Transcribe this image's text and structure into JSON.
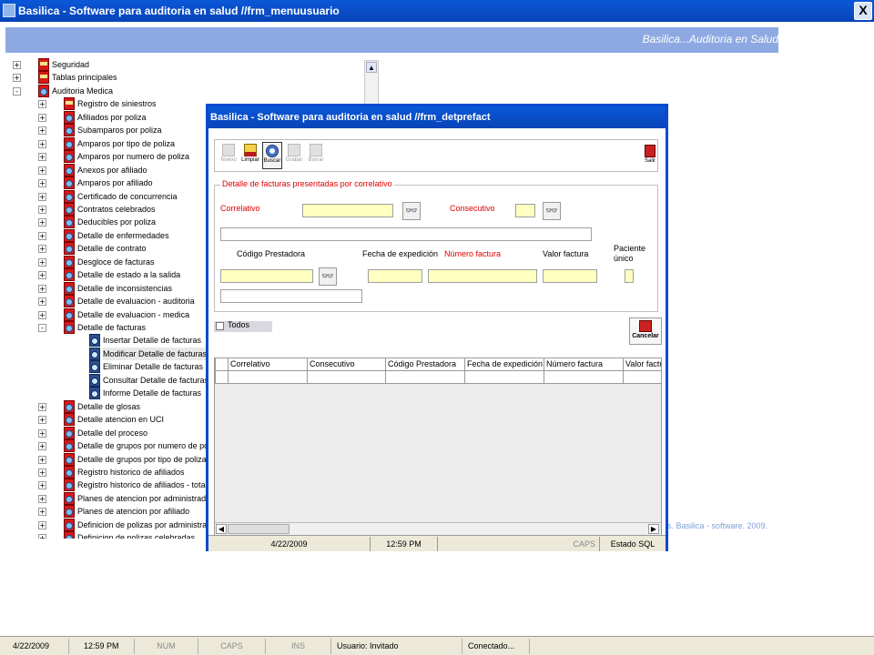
{
  "window": {
    "title": "Basilica - Software para auditoria en salud //frm_menuusuario",
    "close_glyph": "X"
  },
  "banner": {
    "text": "Basilica...Auditoria  en  Salud"
  },
  "tree": [
    {
      "label": "Seguridad",
      "level": 0,
      "expander": "+",
      "icon": "folder-icon"
    },
    {
      "label": "Tablas principales",
      "level": 0,
      "expander": "+",
      "icon": "folder-icon"
    },
    {
      "label": "Auditoria Medica",
      "level": 0,
      "expander": "-",
      "icon": "magnify-icon"
    },
    {
      "label": "Registro de siniestros",
      "level": 1,
      "expander": "+",
      "icon": "folder-icon"
    },
    {
      "label": "Afiliados por poliza",
      "level": 1,
      "expander": "+",
      "icon": "magnify-icon"
    },
    {
      "label": "Subamparos por poliza",
      "level": 1,
      "expander": "+",
      "icon": "magnify-icon"
    },
    {
      "label": "Amparos por tipo de poliza",
      "level": 1,
      "expander": "+",
      "icon": "magnify-icon"
    },
    {
      "label": "Amparos por numero de poliza",
      "level": 1,
      "expander": "+",
      "icon": "magnify-icon"
    },
    {
      "label": "Anexos por afiliado",
      "level": 1,
      "expander": "+",
      "icon": "magnify-icon"
    },
    {
      "label": "Amparos por afiliado",
      "level": 1,
      "expander": "+",
      "icon": "magnify-icon"
    },
    {
      "label": "Certificado de concurrencia",
      "level": 1,
      "expander": "+",
      "icon": "magnify-icon"
    },
    {
      "label": "Contratos celebrados",
      "level": 1,
      "expander": "+",
      "icon": "magnify-icon"
    },
    {
      "label": "Deducibles por poliza",
      "level": 1,
      "expander": "+",
      "icon": "magnify-icon"
    },
    {
      "label": "Detalle de enfermedades",
      "level": 1,
      "expander": "+",
      "icon": "magnify-icon"
    },
    {
      "label": "Detalle de contrato",
      "level": 1,
      "expander": "+",
      "icon": "magnify-icon"
    },
    {
      "label": "Desgloce de facturas",
      "level": 1,
      "expander": "+",
      "icon": "magnify-icon"
    },
    {
      "label": "Detalle de estado a la salida",
      "level": 1,
      "expander": "+",
      "icon": "magnify-icon"
    },
    {
      "label": "Detalle de inconsistencias",
      "level": 1,
      "expander": "+",
      "icon": "magnify-icon"
    },
    {
      "label": "Detalle de evaluacion - auditoria",
      "level": 1,
      "expander": "+",
      "icon": "magnify-icon"
    },
    {
      "label": "Detalle de evaluacion - medica",
      "level": 1,
      "expander": "+",
      "icon": "magnify-icon"
    },
    {
      "label": "Detalle de facturas",
      "level": 1,
      "expander": "-",
      "icon": "magnify-icon"
    },
    {
      "label": "Insertar Detalle de facturas",
      "level": 2,
      "expander": "",
      "icon": "leaf-icon"
    },
    {
      "label": "Modificar Detalle de facturas",
      "level": 2,
      "expander": "",
      "icon": "leaf-icon",
      "selected": true
    },
    {
      "label": "Eliminar Detalle de facturas",
      "level": 2,
      "expander": "",
      "icon": "leaf-icon"
    },
    {
      "label": "Consultar Detalle de facturas",
      "level": 2,
      "expander": "",
      "icon": "leaf-icon"
    },
    {
      "label": "Informe Detalle de facturas",
      "level": 2,
      "expander": "",
      "icon": "leaf-icon"
    },
    {
      "label": "Detalle de glosas",
      "level": 1,
      "expander": "+",
      "icon": "magnify-icon"
    },
    {
      "label": "Detalle atencion en UCI",
      "level": 1,
      "expander": "+",
      "icon": "magnify-icon"
    },
    {
      "label": "Detalle del proceso",
      "level": 1,
      "expander": "+",
      "icon": "magnify-icon"
    },
    {
      "label": "Detalle de grupos por numero de poliza",
      "level": 1,
      "expander": "+",
      "icon": "magnify-icon"
    },
    {
      "label": "Detalle de grupos por tipo de poliza",
      "level": 1,
      "expander": "+",
      "icon": "magnify-icon"
    },
    {
      "label": "Registro historico de afiliados",
      "level": 1,
      "expander": "+",
      "icon": "magnify-icon"
    },
    {
      "label": "Registro historico de afiliados - total",
      "level": 1,
      "expander": "+",
      "icon": "magnify-icon"
    },
    {
      "label": "Planes de atencion por administradora",
      "level": 1,
      "expander": "+",
      "icon": "magnify-icon"
    },
    {
      "label": "Planes de atencion por afiliado",
      "level": 1,
      "expander": "+",
      "icon": "magnify-icon"
    },
    {
      "label": "Definicion de polizas por administradora",
      "level": 1,
      "expander": "+",
      "icon": "magnify-icon"
    },
    {
      "label": "Definicion de polizas celebradas",
      "level": 1,
      "expander": "+",
      "icon": "magnify-icon"
    }
  ],
  "footer": {
    "text": "s. Basilica - software. 2009."
  },
  "dialog": {
    "title": "Basilica - Software para auditoria en salud //frm_detprefact",
    "toolbar": [
      {
        "label": "Nuevo",
        "enabled": false,
        "icon": "new-icon"
      },
      {
        "label": "Limpiar",
        "enabled": true,
        "icon": "clear-icon"
      },
      {
        "label": "Buscar",
        "enabled": true,
        "icon": "search-icon",
        "active": true
      },
      {
        "label": "Grabar",
        "enabled": false,
        "icon": "save-icon"
      },
      {
        "label": "Borrar",
        "enabled": false,
        "icon": "delete-icon"
      }
    ],
    "exit_label": "Salir",
    "group_legend": "Detalle de facturas presentadas por correlativo",
    "labels": {
      "correlativo": "Correlativo",
      "consecutivo": "Consecutivo",
      "codigo_prestadora": "Código Prestadora",
      "fecha_expedicion": "Fecha de expedición",
      "numero_factura": "Número factura",
      "valor_factura": "Valor factura",
      "paciente_unico": "Paciente único"
    },
    "todos_label": "Todos",
    "cancel_label": "Cancelar",
    "grid_columns": [
      "Correlativo",
      "Consecutivo",
      "Código Prestadora",
      "Fecha de expedición",
      "Número factura",
      "Valor factura"
    ],
    "status": {
      "date": "4/22/2009",
      "time": "12:59 PM",
      "caps": "CAPS",
      "sql": "Estado SQL"
    },
    "colors": {
      "required_label": "#e00000",
      "field_fill": "#ffffc0",
      "titlebar": "#0a4ad0"
    }
  },
  "statusbar": {
    "date": "4/22/2009",
    "time": "12:59 PM",
    "num": "NUM",
    "caps": "CAPS",
    "ins": "INS",
    "user": "Usuario: Invitado",
    "connection": "Conectado..."
  }
}
